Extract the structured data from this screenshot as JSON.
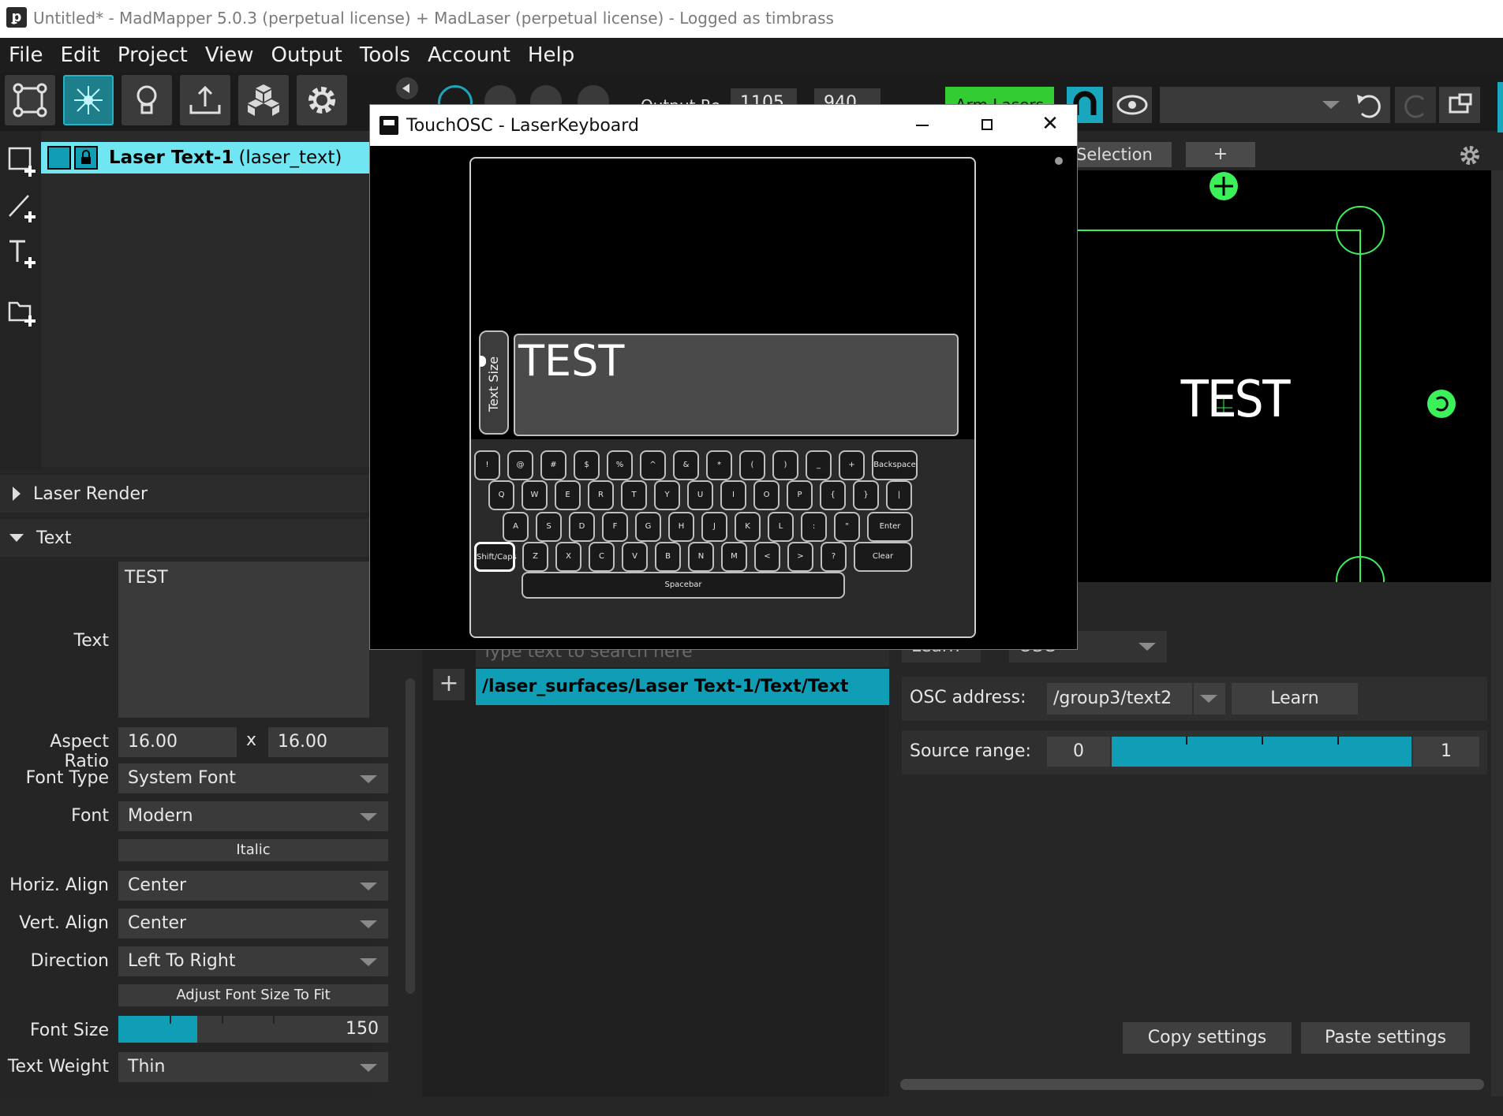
{
  "window": {
    "title": "Untitled* - MadMapper 5.0.3 (perpetual license) + MadLaser (perpetual license) - Logged as timbrass"
  },
  "menu": [
    "File",
    "Edit",
    "Project",
    "View",
    "Output",
    "Tools",
    "Account",
    "Help"
  ],
  "toolbar": {
    "output_res_label": "Output Re",
    "res_width": "1105",
    "res_height": "940",
    "arm_lasers": "Arm Lasers"
  },
  "canvas_tabs": {
    "selection": "Selection",
    "add": "+"
  },
  "surface": {
    "name": "Laser Text-1",
    "type": "(laser_text)"
  },
  "sections": {
    "laser_render": "Laser Render",
    "text": "Text"
  },
  "text_props": {
    "text_label": "Text",
    "text_value": "TEST",
    "aspect_label": "Aspect Ratio",
    "aspect_w": "16.00",
    "aspect_x": "x",
    "aspect_h": "16.00",
    "font_type_label": "Font Type",
    "font_type": "System Font",
    "font_label": "Font",
    "font": "Modern",
    "italic": "Italic",
    "halign_label": "Horiz. Align",
    "halign": "Center",
    "valign_label": "Vert. Align",
    "valign": "Center",
    "direction_label": "Direction",
    "direction": "Left To Right",
    "adjust_btn": "Adjust Font Size To Fit",
    "font_size_label": "Font Size",
    "font_size": "150",
    "font_size_fraction": 0.38,
    "weight_label": "Text Weight",
    "weight": "Thin"
  },
  "midpanel": {
    "search_placeholder": "Type text to search here",
    "address": "/laser_surfaces/Laser Text-1/Text/Text",
    "add": "+"
  },
  "rightpanel": {
    "learn_top": "Learn",
    "protocol": "OSC",
    "osc_label": "OSC address:",
    "osc_value": "/group3/text2",
    "learn": "Learn",
    "range_label": "Source range:",
    "range_min": "0",
    "range_max": "1",
    "copy": "Copy settings",
    "paste": "Paste settings"
  },
  "canvas": {
    "text": "TEST"
  },
  "touchosc": {
    "title": "TouchOSC - LaserKeyboard",
    "text_size": "Text Size",
    "display": "TEST",
    "rows": [
      [
        "!",
        "@",
        "#",
        "$",
        "%",
        "^",
        "&",
        "*",
        "(",
        ")",
        "_",
        "+",
        "Backspace"
      ],
      [
        "Q",
        "W",
        "E",
        "R",
        "T",
        "Y",
        "U",
        "I",
        "O",
        "P",
        "{",
        "}",
        "|"
      ],
      [
        "A",
        "S",
        "D",
        "F",
        "G",
        "H",
        "J",
        "K",
        "L",
        ":",
        "\"",
        "Enter"
      ],
      [
        "Shift/Caps",
        "Z",
        "X",
        "C",
        "V",
        "B",
        "N",
        "M",
        "<",
        ">",
        "?",
        "Clear"
      ]
    ],
    "spacebar": "Spacebar"
  },
  "colors": {
    "accent": "#0f9eb5",
    "highlight": "#6fe6f2",
    "green": "#3cf05a",
    "arm": "#33cc33"
  }
}
